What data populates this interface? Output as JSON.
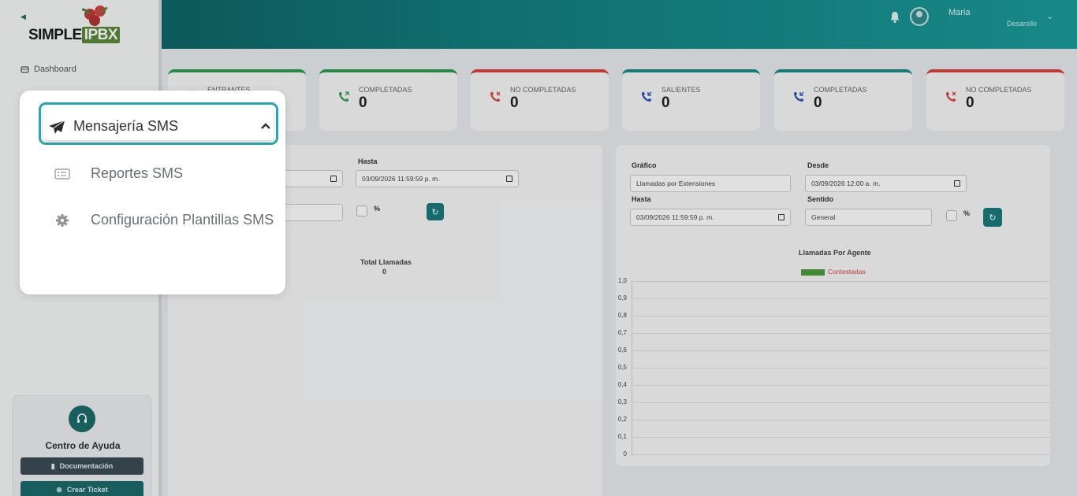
{
  "brand": {
    "logo_simple": "SIMPLE",
    "logo_pbx": "IPBX"
  },
  "user": {
    "name": "Maria",
    "role": "Desarollo"
  },
  "sidebar": {
    "dashboard_label": "Dashboard",
    "help": {
      "title": "Centro de Ayuda",
      "docs_label": "Documentación",
      "ticket_label": "Crear Ticket"
    }
  },
  "stats": [
    {
      "label": "ENTRANTES",
      "value": "",
      "color": "#2e9c4e"
    },
    {
      "label": "COMPLETADAS",
      "value": "0",
      "color": "#2e9c4e"
    },
    {
      "label": "NO COMPLETADAS",
      "value": "0",
      "color": "#d9423a"
    },
    {
      "label": "SALIENTES",
      "value": "0",
      "color": "#1c8a8c"
    },
    {
      "label": "COMPLETADAS",
      "value": "0",
      "color": "#1c8a8c"
    },
    {
      "label": "NO COMPLETADAS",
      "value": "0",
      "color": "#d9423a"
    }
  ],
  "left_panel": {
    "hasta_label": "Hasta",
    "hasta_value": "03/09/2026 11:59:59 p. m.",
    "pct_label": "%",
    "total_label": "Total Llamadas",
    "total_value": "0"
  },
  "right_panel": {
    "grafico_label": "Gráfico",
    "grafico_value": "Llamadas por Extensiones",
    "desde_label": "Desde",
    "desde_value": "03/09/2026 12:00 a. m.",
    "hasta_label": "Hasta",
    "hasta_value": "03/09/2026 11:59:59 p. m.",
    "sentido_label": "Sentido",
    "sentido_value": "General",
    "pct_label": "%"
  },
  "chart_data": {
    "type": "bar",
    "title": "Llamadas Por Agente",
    "categories": [],
    "series": [
      {
        "name": "Contestadas",
        "values": []
      }
    ],
    "yticks": [
      "1,0",
      "0,9",
      "0,8",
      "0,7",
      "0,6",
      "0,5",
      "0,4",
      "0,3",
      "0,2",
      "0,1",
      "0"
    ],
    "ylim": [
      0,
      1
    ],
    "grid": true,
    "legend": "top-center",
    "series_color": "#4c9b3a",
    "legend_text_color": "#d9423a"
  },
  "popup": {
    "section_label": "Mensajería SMS",
    "items": [
      {
        "label": "Reportes SMS",
        "icon": "list-card-icon"
      },
      {
        "label": "Configuración Plantillas SMS",
        "icon": "gear-icon"
      }
    ]
  },
  "colors": {
    "primary": "#1c6b6d",
    "highlight": "#2aa6ad"
  }
}
